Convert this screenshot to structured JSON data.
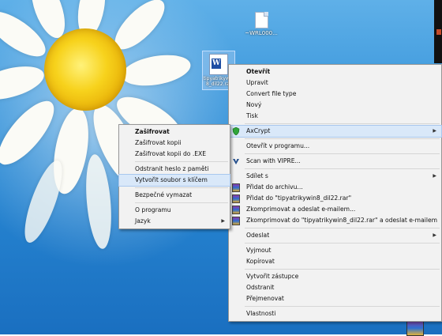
{
  "desktop": {
    "icons": [
      {
        "label": "~WRL000..."
      },
      {
        "label": "tipyatrikywin8_dil22.rar"
      }
    ]
  },
  "context_menu": {
    "items": [
      {
        "label": "Otevřít",
        "bold": true
      },
      {
        "label": "Upravit"
      },
      {
        "label": "Convert file type"
      },
      {
        "label": "Nový"
      },
      {
        "label": "Tisk"
      },
      {
        "sep": true
      },
      {
        "label": "AxCrypt",
        "icon": "axcrypt-shield-icon",
        "submenu": true,
        "highlighted": true
      },
      {
        "sep": true
      },
      {
        "label": "Otevřít v programu..."
      },
      {
        "sep": true
      },
      {
        "label": "Scan with VIPRE...",
        "icon": "vipre-icon"
      },
      {
        "sep": true
      },
      {
        "label": "Sdílet s",
        "submenu": true
      },
      {
        "label": "Přidat do archivu...",
        "icon": "winrar-icon"
      },
      {
        "label": "Přidat do \"tipyatrikywin8_dil22.rar\"",
        "icon": "winrar-icon"
      },
      {
        "label": "Zkomprimovat a odeslat e-mailem...",
        "icon": "winrar-icon"
      },
      {
        "label": "Zkomprimovat do \"tipyatrikywin8_dil22.rar\" a odeslat e-mailem",
        "icon": "winrar-icon"
      },
      {
        "sep": true
      },
      {
        "label": "Odeslat",
        "submenu": true
      },
      {
        "sep": true
      },
      {
        "label": "Vyjmout"
      },
      {
        "label": "Kopírovat"
      },
      {
        "sep": true
      },
      {
        "label": "Vytvořit zástupce"
      },
      {
        "label": "Odstranit"
      },
      {
        "label": "Přejmenovat"
      },
      {
        "sep": true
      },
      {
        "label": "Vlastnosti"
      }
    ]
  },
  "axcrypt_submenu": {
    "items": [
      {
        "label": "Zašifrovat",
        "bold": true
      },
      {
        "label": "Zašifrovat kopii"
      },
      {
        "label": "Zašifrovat kopii do .EXE"
      },
      {
        "sep": true
      },
      {
        "label": "Odstranit heslo z paměti"
      },
      {
        "label": "Vytvořit soubor s klíčem",
        "highlighted": true
      },
      {
        "sep": true
      },
      {
        "label": "Bezpečné vymazat"
      },
      {
        "sep": true
      },
      {
        "label": "O programu"
      },
      {
        "label": "Jazyk",
        "submenu": true
      }
    ]
  },
  "colors": {
    "menu_bg": "#f2f2f2",
    "highlight": "#d9e8f9",
    "highlight_border": "#a8c7ee",
    "desktop_blue": "#2a8bd6"
  }
}
